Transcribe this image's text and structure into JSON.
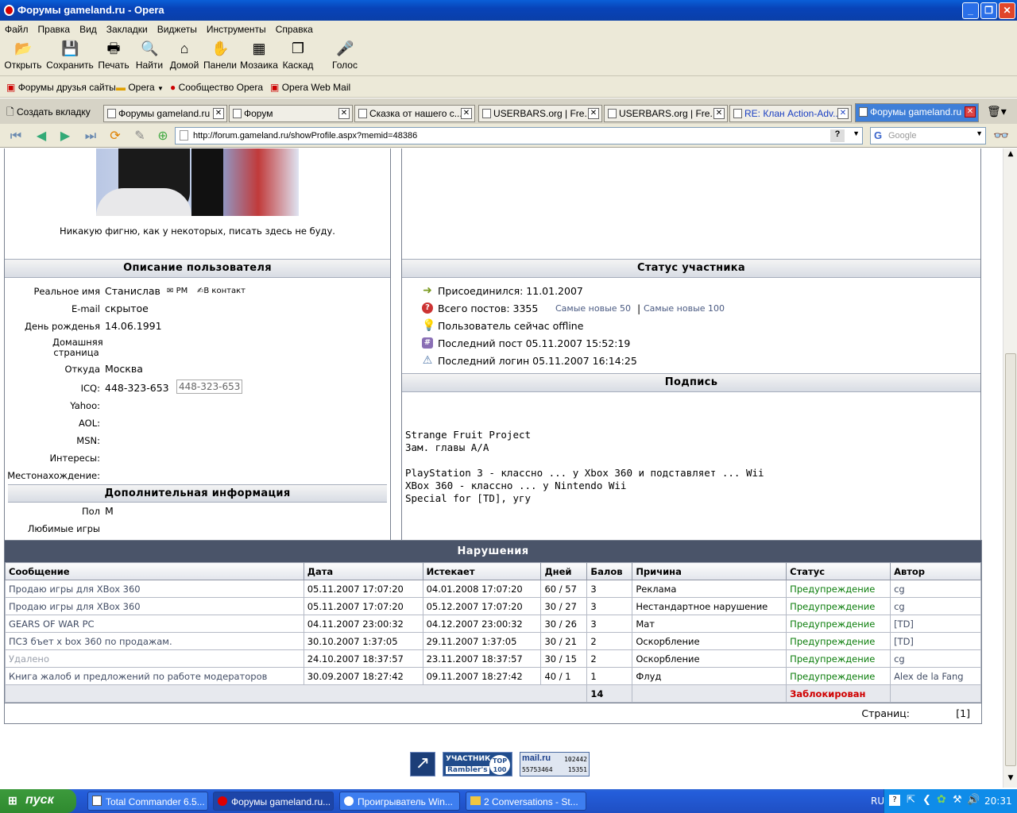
{
  "window": {
    "title": "Форумы gameland.ru - Opera"
  },
  "menu": [
    "Файл",
    "Правка",
    "Вид",
    "Закладки",
    "Виджеты",
    "Инструменты",
    "Справка"
  ],
  "toolbar": [
    {
      "label": "Открыть",
      "icon": "folder-icon"
    },
    {
      "label": "Сохранить",
      "icon": "save-icon"
    },
    {
      "label": "Печать",
      "icon": "print-icon"
    },
    {
      "label": "Найти",
      "icon": "search-icon"
    },
    {
      "label": "Домой",
      "icon": "home-icon"
    },
    {
      "label": "Панели",
      "icon": "panels-icon"
    },
    {
      "label": "Мозаика",
      "icon": "tile-icon"
    },
    {
      "label": "Каскад",
      "icon": "cascade-icon"
    },
    {
      "label": "Голос",
      "icon": "voice-icon"
    }
  ],
  "bookmarks": [
    "Форумы друзья сайты",
    "Opera",
    "Сообщество Opera",
    "Opera Web Mail"
  ],
  "tabs": {
    "new_tab": "Создать вкладку",
    "items": [
      "Форумы gameland.ru",
      "Форум",
      "Сказка от нашего с...",
      "USERBARS.org | Fre...",
      "USERBARS.org | Fre...",
      "RE: Клан Action-Adv...",
      "Форумы gameland.ru"
    ]
  },
  "address": {
    "url": "http://forum.gameland.ru/showProfile.aspx?memid=48386",
    "search_placeholder": "Google"
  },
  "profile": {
    "tagline": "Никакую фигню, как у некоторых, писать здесь не буду.",
    "desc_header": "Описание пользователя",
    "fields": [
      {
        "label": "Реальное имя",
        "value": "Станислав"
      },
      {
        "label": "E-mail",
        "value": "скрытое"
      },
      {
        "label": "День рожденья",
        "value": "14.06.1991"
      },
      {
        "label": "Домашняя страница",
        "value": ""
      },
      {
        "label": "Откуда",
        "value": "Москва"
      },
      {
        "label": "ICQ:",
        "value": "448-323-653"
      },
      {
        "label": "Yahoo:",
        "value": ""
      },
      {
        "label": "AOL:",
        "value": ""
      },
      {
        "label": "MSN:",
        "value": ""
      },
      {
        "label": "Интересы:",
        "value": ""
      },
      {
        "label": "Местонахождение:",
        "value": ""
      }
    ],
    "pm_label": "PM",
    "vk_label": "В контакт",
    "icq_box": "448-323-653",
    "extra_header": "Дополнительная информация",
    "extra": [
      {
        "label": "Пол",
        "value": "М"
      },
      {
        "label": "Любимые игры",
        "value": ""
      }
    ]
  },
  "status": {
    "header": "Статус участника",
    "joined": "Присоединился: 11.01.2007",
    "posts": "Всего постов: 3355",
    "newest50": "Самые новые 50",
    "sep": "|",
    "newest100": "Самые новые 100",
    "online": "Пользователь сейчас offline",
    "last_post": "Последний пост 05.11.2007 15:52:19",
    "last_login": "Последний логин 05.11.2007 16:14:25"
  },
  "signature": {
    "header": "Подпись",
    "lines": [
      "Strange Fruit Project",
      "Зам. главы А/А",
      "",
      "PlayStation 3 - классно ... у Xbox 360 и подставляет ... Wii",
      "XBox 360 - классно ... у Nintendo Wii",
      "Special for [TD], угу"
    ]
  },
  "violations": {
    "title": "Нарушения",
    "columns": [
      "Сообщение",
      "Дата",
      "Истекает",
      "Дней",
      "Балов",
      "Причина",
      "Статус",
      "Автор"
    ],
    "rows": [
      [
        "Продаю игры для XBox 360",
        "05.11.2007 17:07:20",
        "04.01.2008 17:07:20",
        "60 / 57",
        "3",
        "Реклама",
        "Предупреждение",
        "cg"
      ],
      [
        "Продаю игры для XBox 360",
        "05.11.2007 17:07:20",
        "05.12.2007 17:07:20",
        "30 / 27",
        "3",
        "Нестандартное нарушение",
        "Предупреждение",
        "cg"
      ],
      [
        "GEARS OF WAR PC",
        "04.11.2007 23:00:32",
        "04.12.2007 23:00:32",
        "30 / 26",
        "3",
        "Мат",
        "Предупреждение",
        "[TD]"
      ],
      [
        "ПС3 бъет x box 360 по продажам.",
        "30.10.2007 1:37:05",
        "29.11.2007 1:37:05",
        "30 / 21",
        "2",
        "Оскорбление",
        "Предупреждение",
        "[TD]"
      ],
      [
        "Удалено",
        "24.10.2007 18:37:57",
        "23.11.2007 18:37:57",
        "30 / 15",
        "2",
        "Оскорбление",
        "Предупреждение",
        "cg"
      ],
      [
        "Книга жалоб и предложений по работе модераторов",
        "30.09.2007 18:27:42",
        "09.11.2007 18:27:42",
        "40 / 1",
        "1",
        "Флуд",
        "Предупреждение",
        "Alex de la Fang"
      ]
    ],
    "total_points": "14",
    "total_status": "Заблокирован",
    "pages_label": "Страниц:",
    "pages_value": "[1]"
  },
  "counters": {
    "rambler_top": "УЧАСТНИК",
    "rambler_bottom": "Rambler's",
    "rambler_badge": "TOP 100",
    "mail_logo": "mail.ru",
    "mail_a": "102442",
    "mail_b": "55753464",
    "mail_c": "15351"
  },
  "taskbar": {
    "start": "пуск",
    "tasks": [
      "Total Commander 6.5...",
      "Форумы gameland.ru...",
      "Проигрыватель Win...",
      "2 Conversations - St..."
    ],
    "lang": "RU",
    "time": "20:31"
  }
}
